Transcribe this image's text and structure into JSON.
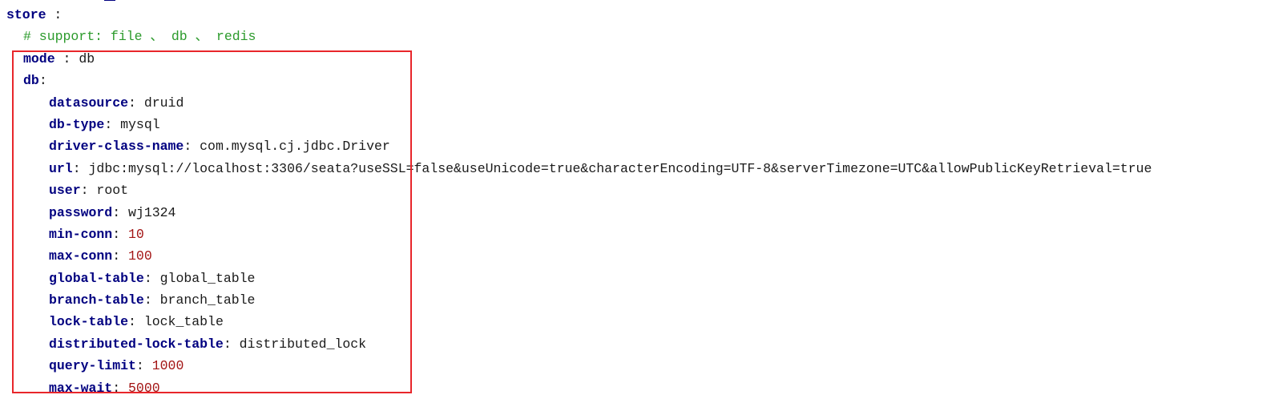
{
  "config": {
    "store": {
      "key": "store",
      "sep": " :"
    },
    "comment": "# support: file 、 db 、 redis",
    "mode": {
      "key": "mode",
      "sep": " : ",
      "value": "db"
    },
    "db": {
      "key": "db",
      "sep": ":"
    },
    "entries": [
      {
        "key": "datasource",
        "value": "druid",
        "type": "string"
      },
      {
        "key": "db-type",
        "value": "mysql",
        "type": "string"
      },
      {
        "key": "driver-class-name",
        "value": "com.mysql.cj.jdbc.Driver",
        "type": "string"
      },
      {
        "key": "url",
        "value": "jdbc:mysql://localhost:3306/seata?useSSL=false&useUnicode=true&characterEncoding=UTF-8&serverTimezone=UTC&allowPublicKeyRetrieval=true",
        "type": "string"
      },
      {
        "key": "user",
        "value": "root",
        "type": "string"
      },
      {
        "key": "password",
        "value": "wj1324",
        "type": "string"
      },
      {
        "key": "min-conn",
        "value": "10",
        "type": "number"
      },
      {
        "key": "max-conn",
        "value": "100",
        "type": "number"
      },
      {
        "key": "global-table",
        "value": "global_table",
        "type": "string"
      },
      {
        "key": "branch-table",
        "value": "branch_table",
        "type": "string"
      },
      {
        "key": "lock-table",
        "value": "lock_table",
        "type": "string"
      },
      {
        "key": "distributed-lock-table",
        "value": "distributed_lock",
        "type": "string"
      },
      {
        "key": "query-limit",
        "value": "1000",
        "type": "number"
      },
      {
        "key": "max-wait",
        "value": "5000",
        "type": "number"
      }
    ]
  },
  "colors": {
    "key": "#000080",
    "string_value": "#1a1a1a",
    "number_value": "#a31515",
    "comment": "#2b9a2b",
    "highlight_border": "#e8262b"
  }
}
